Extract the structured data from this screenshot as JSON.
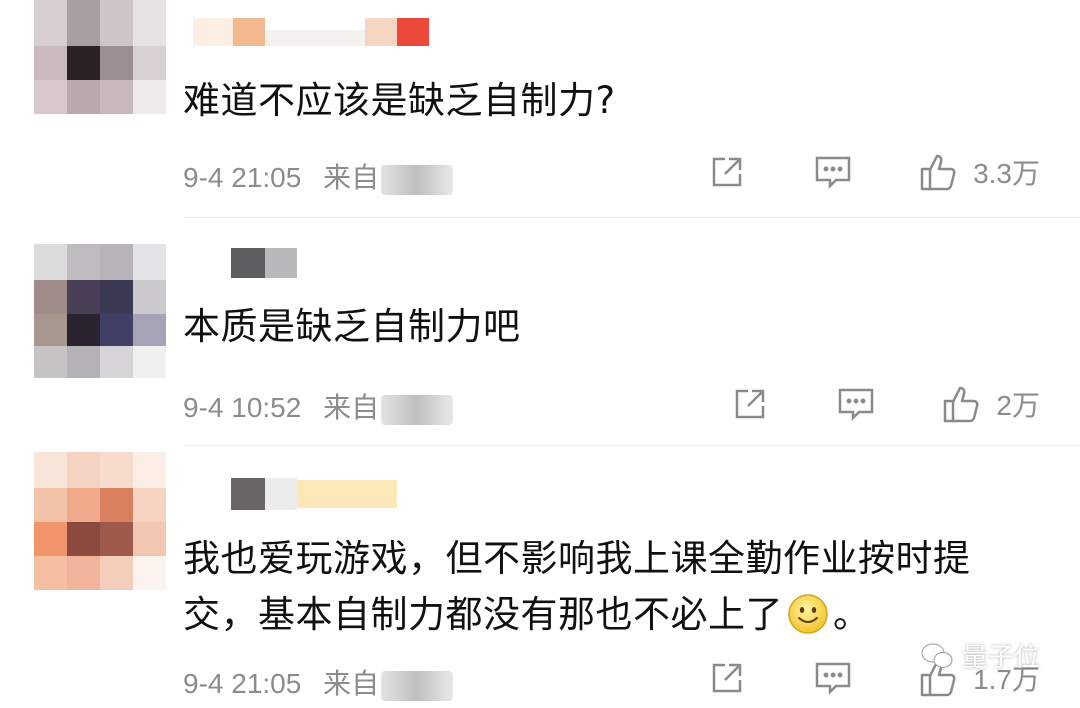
{
  "comments": [
    {
      "text": "难道不应该是缺乏自制力?",
      "time": "9-4 21:05",
      "from_label": "来自",
      "likes": "3.3万"
    },
    {
      "text": "本质是缺乏自制力吧",
      "time": "9-4 10:52",
      "from_label": "来自",
      "likes": "2万"
    },
    {
      "text_line1": "我也爱玩游戏，但不影响我上课全勤作业按时提",
      "text_line2": "交，基本自制力都没有那也不必上了",
      "text_end": "。",
      "time": "9-4 21:05",
      "from_label": "来自",
      "likes": "1.7万"
    }
  ],
  "icons": {
    "share": "share-icon",
    "comment": "comment-icon",
    "like": "thumbs-up-icon",
    "emoji": "smile-emoji-icon"
  },
  "watermark": {
    "text": "量子位"
  },
  "colors": {
    "meta": "#8c8c8c",
    "text": "#111111",
    "divider": "#ececec"
  }
}
